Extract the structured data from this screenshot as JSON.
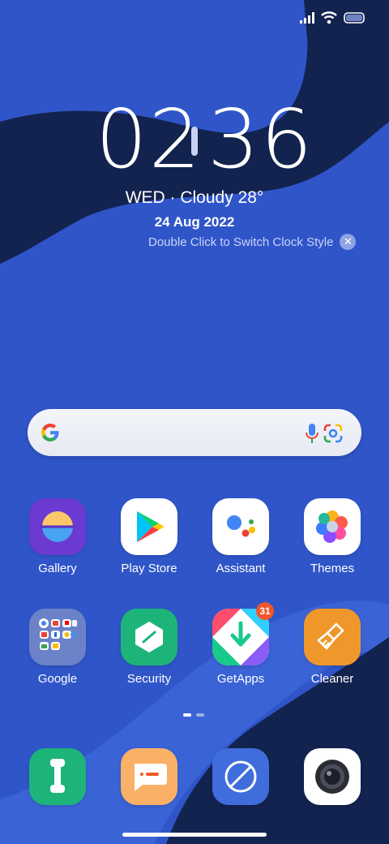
{
  "wallpaper": {
    "base_color": "#2f55c9",
    "dark_wave_color": "#13234f",
    "mid_wave_color": "#3a63d6"
  },
  "status_bar": {
    "icons": [
      "cellular-signal-icon",
      "wifi-icon",
      "battery-icon"
    ]
  },
  "clock": {
    "hours": "02",
    "minutes": "36"
  },
  "weather": {
    "text": "WED · Cloudy 28°"
  },
  "date": {
    "text": "24 Aug 2022"
  },
  "clock_hint": {
    "text": "Double Click to Switch Clock Style",
    "close_glyph": "✕"
  },
  "search": {
    "icons": [
      "google-g-icon",
      "microphone-icon",
      "google-lens-icon"
    ]
  },
  "apps": [
    {
      "label": "Gallery",
      "icon": "gallery-icon",
      "color": "#6a3ad1"
    },
    {
      "label": "Play Store",
      "icon": "play-store-icon",
      "color": "#ffffff"
    },
    {
      "label": "Assistant",
      "icon": "assistant-icon",
      "color": "#ffffff"
    },
    {
      "label": "Themes",
      "icon": "themes-icon",
      "color": "#ffffff"
    },
    {
      "label": "Google",
      "icon": "google-folder-icon",
      "color": "#6b82c9"
    },
    {
      "label": "Security",
      "icon": "security-icon",
      "color": "#1db47a"
    },
    {
      "label": "GetApps",
      "icon": "getapps-icon",
      "color": "#ffffff",
      "badge": "31"
    },
    {
      "label": "Cleaner",
      "icon": "cleaner-icon",
      "color": "#f0972b"
    }
  ],
  "dock": [
    {
      "icon": "phone-icon",
      "color": "#1db47a"
    },
    {
      "icon": "messages-icon",
      "color": "#fbb068"
    },
    {
      "icon": "browser-icon",
      "color": "#3f6ddc"
    },
    {
      "icon": "camera-icon",
      "color": "#ffffff"
    }
  ],
  "pager": {
    "pages": 2,
    "current": 1
  }
}
